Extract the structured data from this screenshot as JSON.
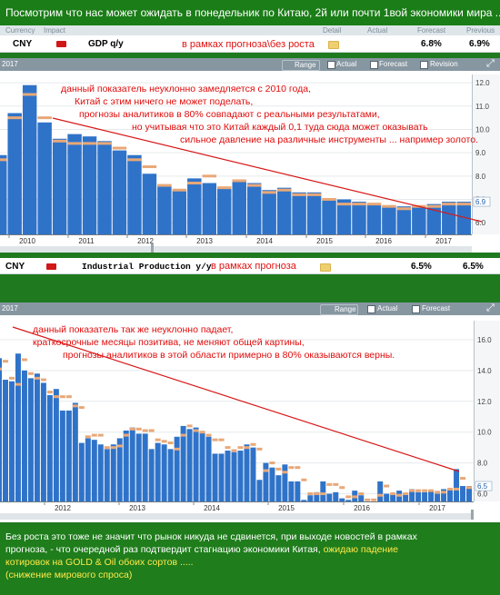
{
  "banner": {
    "text": "Посмотрим что нас может ожидать в понедельник по Китаю, 2й или почти 1вой экономики мира ..."
  },
  "header": {
    "currency": "Currency",
    "impact": "Impact",
    "detail": "Detail",
    "actual": "Actual",
    "forecast": "Forecast",
    "previous": "Previous"
  },
  "gdp_row": {
    "currency": "CNY",
    "event": "GDP q/y",
    "note": "в рамках прогноза\\без роста",
    "forecast": "6.8%",
    "previous": "6.9%"
  },
  "toolbar1": {
    "year": "2017",
    "range": "Range",
    "actual": "Actual",
    "forecast": "Forecast",
    "revision": "Revision"
  },
  "chart1": {
    "annotation": [
      "данный показатель неуклонно замедляется с 2010 года,",
      "Китай с этим ничего не может поделать,",
      "прогнозы аналитиков в 80% совпадают с реальными результатами,",
      "но учитывая что это Китай каждый 0,1 туда сюда может оказывать",
      "сильное давление на различные инструменты ... например золото."
    ],
    "years": [
      "2010",
      "2011",
      "2012",
      "2013",
      "2014",
      "2015",
      "2016",
      "2017"
    ],
    "yticks": [
      "12.0",
      "11.0",
      "10.0",
      "9.0",
      "8.0",
      "7.0",
      "6.0"
    ],
    "last_label": "6.9"
  },
  "ip_row": {
    "currency": "CNY",
    "event": "Industrial Production y/y",
    "note": "в рамках прогноза",
    "forecast": "6.5%",
    "previous": "6.5%"
  },
  "toolbar2": {
    "year": "2017",
    "range": "Range",
    "actual": "Actual",
    "forecast": "Forecast"
  },
  "chart2": {
    "annotation": [
      "данный показатель так же неуклонно падает,",
      "краткосрочные месяцы позитива, не меняют общей картины,",
      "прогнозы аналитиков в этой области примерно в 80% оказываются верны."
    ],
    "years": [
      "2012",
      "2013",
      "2014",
      "2015",
      "2016",
      "2017"
    ],
    "yticks": [
      "16.0",
      "14.0",
      "12.0",
      "10.0",
      "8.0",
      "6.0"
    ],
    "last_label": "6.5"
  },
  "footer": {
    "line1": "Без роста это тоже не значит что рынок никуда не сдвинется, при выходе новостей в рамках",
    "line2a": "прогноза, - что очередной раз подтвердит стагнацию экономики Китая, ",
    "line2b": "ожидаю падение",
    "line3": "котировок на GOLD & Oil обоих сортов .....",
    "line4": "(снижение мирового спроса)"
  },
  "colors": {
    "bar": "#2f73c9",
    "forecast_marker": "#e8a878",
    "trend": "#d81818",
    "banner": "#1a7d17"
  },
  "chart_data": [
    {
      "type": "bar",
      "title": "GDP q/y",
      "categories": [
        "2009Q3",
        "2009Q4",
        "2010Q1",
        "2010Q2",
        "2010Q3",
        "2010Q4",
        "2011Q1",
        "2011Q2",
        "2011Q3",
        "2011Q4",
        "2012Q1",
        "2012Q2",
        "2012Q3",
        "2012Q4",
        "2013Q1",
        "2013Q2",
        "2013Q3",
        "2013Q4",
        "2014Q1",
        "2014Q2",
        "2014Q3",
        "2014Q4",
        "2015Q1",
        "2015Q2",
        "2015Q3",
        "2015Q4",
        "2016Q1",
        "2016Q2",
        "2016Q3",
        "2016Q4",
        "2017Q1",
        "2017Q2"
      ],
      "series": [
        {
          "name": "Actual",
          "values": [
            8.9,
            10.7,
            11.9,
            10.3,
            9.6,
            9.8,
            9.7,
            9.5,
            9.1,
            8.9,
            8.1,
            7.6,
            7.4,
            7.9,
            7.7,
            7.5,
            7.8,
            7.7,
            7.4,
            7.5,
            7.3,
            7.3,
            7.0,
            7.0,
            6.9,
            6.8,
            6.7,
            6.7,
            6.7,
            6.8,
            6.9,
            6.9
          ]
        },
        {
          "name": "Forecast",
          "values": [
            8.7,
            10.5,
            11.5,
            10.5,
            9.5,
            9.4,
            9.4,
            9.4,
            9.2,
            8.7,
            8.4,
            7.6,
            7.4,
            7.7,
            8.0,
            7.5,
            7.8,
            7.6,
            7.3,
            7.4,
            7.2,
            7.2,
            7.0,
            6.8,
            6.8,
            6.8,
            6.7,
            6.6,
            6.7,
            6.7,
            6.8,
            6.8
          ]
        }
      ],
      "ylim": [
        5.5,
        12.2
      ]
    },
    {
      "type": "bar",
      "title": "Industrial Production y/y",
      "categories": [
        "2011-03",
        "2011-04",
        "2011-05",
        "2011-06",
        "2011-07",
        "2011-08",
        "2011-09",
        "2011-10",
        "2011-11",
        "2011-12",
        "2012-01",
        "2012-02",
        "2012-03",
        "2012-04",
        "2012-05",
        "2012-06",
        "2012-07",
        "2012-08",
        "2012-09",
        "2012-10",
        "2012-11",
        "2012-12",
        "2013-01",
        "2013-02",
        "2013-03",
        "2013-04",
        "2013-05",
        "2013-06",
        "2013-07",
        "2013-08",
        "2013-09",
        "2013-10",
        "2013-11",
        "2013-12",
        "2014-01",
        "2014-02",
        "2014-03",
        "2014-04",
        "2014-05",
        "2014-06",
        "2014-07",
        "2014-08",
        "2014-09",
        "2014-10",
        "2014-11",
        "2014-12",
        "2015-01",
        "2015-02",
        "2015-03",
        "2015-04",
        "2015-05",
        "2015-06",
        "2015-07",
        "2015-08",
        "2015-09",
        "2015-10",
        "2015-11",
        "2015-12",
        "2016-01",
        "2016-02",
        "2016-03",
        "2016-04",
        "2016-05",
        "2016-06",
        "2016-07",
        "2016-08",
        "2016-09",
        "2016-10",
        "2016-11",
        "2016-12",
        "2017-01",
        "2017-02",
        "2017-03",
        "2017-04",
        "2017-05"
      ],
      "series": [
        {
          "name": "Actual",
          "values": [
            14.8,
            13.4,
            13.3,
            15.1,
            14.0,
            13.5,
            13.8,
            13.2,
            12.4,
            12.8,
            11.4,
            11.4,
            11.9,
            9.3,
            9.6,
            9.5,
            9.2,
            8.9,
            9.2,
            9.6,
            10.1,
            10.3,
            9.9,
            9.9,
            8.9,
            9.3,
            9.2,
            8.9,
            9.7,
            10.4,
            10.2,
            10.3,
            10.0,
            9.7,
            8.6,
            8.6,
            8.8,
            8.7,
            8.8,
            9.2,
            9.0,
            6.9,
            8.0,
            7.7,
            7.2,
            7.9,
            6.8,
            6.8,
            5.6,
            5.9,
            6.1,
            6.8,
            6.0,
            6.1,
            5.7,
            5.6,
            6.2,
            5.9,
            5.4,
            5.4,
            6.8,
            6.0,
            6.0,
            6.2,
            6.0,
            6.3,
            6.1,
            6.1,
            6.2,
            6.0,
            6.3,
            6.3,
            7.6,
            6.5,
            6.5
          ]
        },
        {
          "name": "Forecast",
          "values": [
            14.1,
            14.6,
            13.5,
            13.1,
            14.7,
            13.8,
            13.5,
            13.4,
            12.6,
            12.3,
            12.3,
            12.3,
            11.7,
            11.6,
            9.7,
            9.8,
            9.8,
            9.0,
            9.0,
            9.1,
            9.8,
            10.2,
            10.2,
            10.1,
            10.1,
            9.5,
            9.4,
            9.3,
            8.9,
            9.8,
            10.4,
            10.1,
            10.0,
            9.8,
            9.5,
            9.5,
            9.0,
            8.8,
            9.0,
            9.0,
            9.2,
            8.9,
            7.5,
            8.0,
            7.6,
            7.4,
            7.7,
            7.7,
            6.9,
            6.0,
            6.0,
            6.0,
            6.6,
            6.6,
            6.4,
            5.8,
            5.8,
            6.0,
            5.6,
            5.6,
            5.9,
            6.5,
            6.0,
            5.9,
            6.0,
            6.2,
            6.2,
            6.2,
            6.2,
            6.1,
            6.1,
            6.3,
            6.3,
            7.0,
            6.4
          ]
        }
      ],
      "ylim": [
        5.5,
        17.0
      ]
    }
  ]
}
